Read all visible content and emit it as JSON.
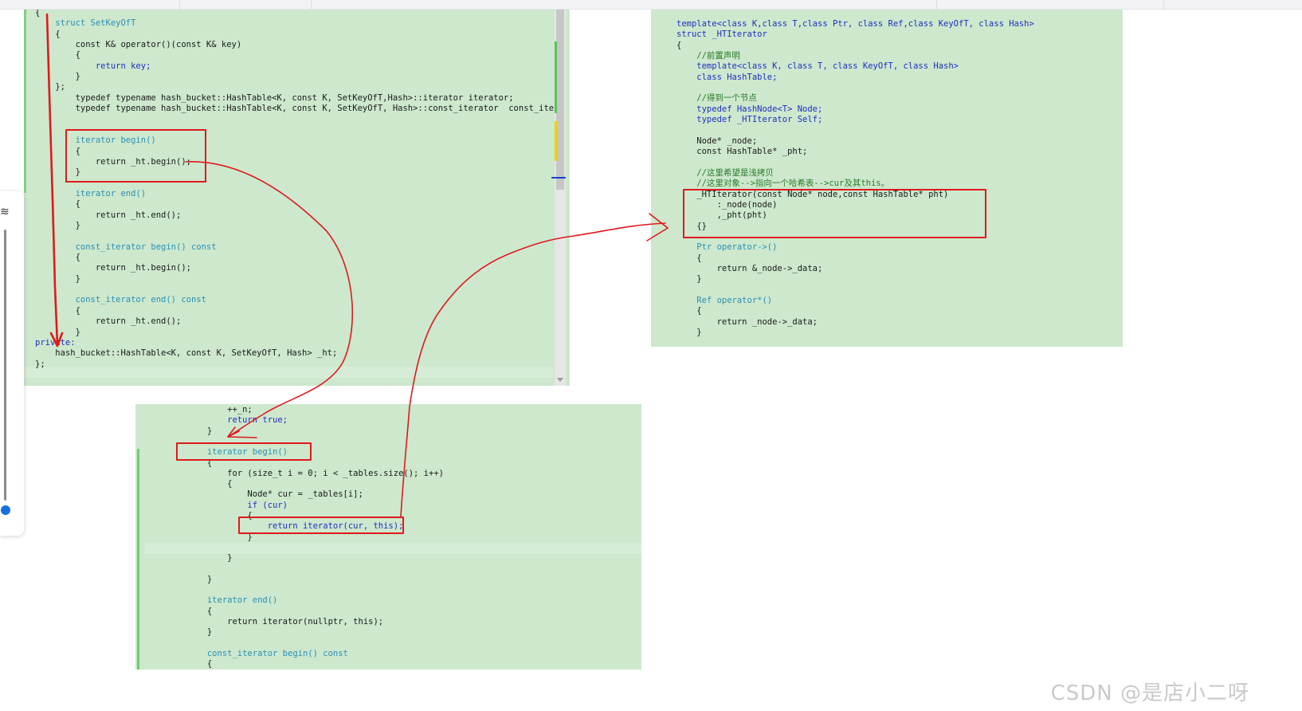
{
  "panel_a": {
    "lines": [
      {
        "t": "{",
        "c": ""
      },
      {
        "t": "    struct SetKeyOfT",
        "c": "ty"
      },
      {
        "t": "    {",
        "c": ""
      },
      {
        "t": "        const K& operator()(const K& key)",
        "c": ""
      },
      {
        "t": "        {",
        "c": ""
      },
      {
        "t": "            return key;",
        "c": "kw"
      },
      {
        "t": "        }",
        "c": ""
      },
      {
        "t": "    };",
        "c": ""
      },
      {
        "t": "        typedef typename hash_bucket::HashTable<K, const K, SetKeyOfT,Hash>::iterator iterator;",
        "c": ""
      },
      {
        "t": "        typedef typename hash_bucket::HashTable<K, const K, SetKeyOfT, Hash>::const_iterator  const_iter",
        "c": ""
      },
      {
        "t": "",
        "c": ""
      },
      {
        "t": "",
        "c": ""
      },
      {
        "t": "        iterator begin()",
        "c": "ty"
      },
      {
        "t": "        {",
        "c": ""
      },
      {
        "t": "            return _ht.begin();",
        "c": ""
      },
      {
        "t": "        }",
        "c": ""
      },
      {
        "t": "",
        "c": ""
      },
      {
        "t": "        iterator end()",
        "c": "ty"
      },
      {
        "t": "        {",
        "c": ""
      },
      {
        "t": "            return _ht.end();",
        "c": ""
      },
      {
        "t": "        }",
        "c": ""
      },
      {
        "t": "",
        "c": ""
      },
      {
        "t": "        const_iterator begin() const",
        "c": "ty"
      },
      {
        "t": "        {",
        "c": ""
      },
      {
        "t": "            return _ht.begin();",
        "c": ""
      },
      {
        "t": "        }",
        "c": ""
      },
      {
        "t": "",
        "c": ""
      },
      {
        "t": "        const_iterator end() const",
        "c": "ty"
      },
      {
        "t": "        {",
        "c": ""
      },
      {
        "t": "            return _ht.end();",
        "c": ""
      },
      {
        "t": "        }",
        "c": ""
      },
      {
        "t": "private:",
        "c": "kw"
      },
      {
        "t": "    hash_bucket::HashTable<K, const K, SetKeyOfT, Hash> _ht;",
        "c": ""
      },
      {
        "t": "};",
        "c": ""
      }
    ]
  },
  "panel_b": {
    "lines": [
      {
        "t": "template<class K,class T,class Ptr, class Ref,class KeyOfT, class Hash>",
        "c": "kw"
      },
      {
        "t": "struct _HTIterator",
        "c": "kw"
      },
      {
        "t": "{",
        "c": ""
      },
      {
        "t": "    //前置声明",
        "c": "cm"
      },
      {
        "t": "    template<class K, class T, class KeyOfT, class Hash>",
        "c": "kw"
      },
      {
        "t": "    class HashTable;",
        "c": "kw"
      },
      {
        "t": "",
        "c": ""
      },
      {
        "t": "    //得到一个节点",
        "c": "cm"
      },
      {
        "t": "    typedef HashNode<T> Node;",
        "c": "kw"
      },
      {
        "t": "    typedef _HTIterator Self;",
        "c": "kw"
      },
      {
        "t": "",
        "c": ""
      },
      {
        "t": "    Node* _node;",
        "c": ""
      },
      {
        "t": "    const HashTable* _pht;",
        "c": ""
      },
      {
        "t": "",
        "c": ""
      },
      {
        "t": "    //这里希望是浅拷贝",
        "c": "cm"
      },
      {
        "t": "    //这里对象-->指向一个哈希表-->cur及其this。",
        "c": "cm"
      },
      {
        "t": "    _HTIterator(const Node* node,const HashTable* pht)",
        "c": ""
      },
      {
        "t": "        :_node(node)",
        "c": ""
      },
      {
        "t": "        ,_pht(pht)",
        "c": ""
      },
      {
        "t": "    {}",
        "c": ""
      },
      {
        "t": "",
        "c": ""
      },
      {
        "t": "    Ptr operator->()",
        "c": "ty"
      },
      {
        "t": "    {",
        "c": ""
      },
      {
        "t": "        return &_node->_data;",
        "c": ""
      },
      {
        "t": "    }",
        "c": ""
      },
      {
        "t": "",
        "c": ""
      },
      {
        "t": "    Ref operator*()",
        "c": "ty"
      },
      {
        "t": "    {",
        "c": ""
      },
      {
        "t": "        return _node->_data;",
        "c": ""
      },
      {
        "t": "    }",
        "c": ""
      }
    ]
  },
  "panel_c": {
    "lines": [
      {
        "t": "                ++_n;",
        "c": ""
      },
      {
        "t": "                return true;",
        "c": "kw"
      },
      {
        "t": "            }",
        "c": ""
      },
      {
        "t": "",
        "c": ""
      },
      {
        "t": "            iterator begin()",
        "c": "ty"
      },
      {
        "t": "            {",
        "c": ""
      },
      {
        "t": "                for (size_t i = 0; i < _tables.size(); i++)",
        "c": ""
      },
      {
        "t": "                {",
        "c": ""
      },
      {
        "t": "                    Node* cur = _tables[i];",
        "c": ""
      },
      {
        "t": "                    if (cur)",
        "c": "kw"
      },
      {
        "t": "                    {",
        "c": ""
      },
      {
        "t": "                        return iterator(cur, this);",
        "c": "kw"
      },
      {
        "t": "                    }",
        "c": ""
      },
      {
        "t": "",
        "c": ""
      },
      {
        "t": "                }",
        "c": ""
      },
      {
        "t": "",
        "c": ""
      },
      {
        "t": "            }",
        "c": ""
      },
      {
        "t": "",
        "c": ""
      },
      {
        "t": "            iterator end()",
        "c": "ty"
      },
      {
        "t": "            {",
        "c": ""
      },
      {
        "t": "                return iterator(nullptr, this);",
        "c": ""
      },
      {
        "t": "            }",
        "c": ""
      },
      {
        "t": "",
        "c": ""
      },
      {
        "t": "            const_iterator begin() const",
        "c": "ty"
      },
      {
        "t": "            {",
        "c": ""
      }
    ]
  },
  "sidebar": {
    "glyph": "≋"
  },
  "watermark": "CSDN @是店小二呀",
  "colors": {
    "panel_bg": "#cde8cd",
    "annotation_red": "#e0191c",
    "keyword": "#1f2fbf"
  }
}
